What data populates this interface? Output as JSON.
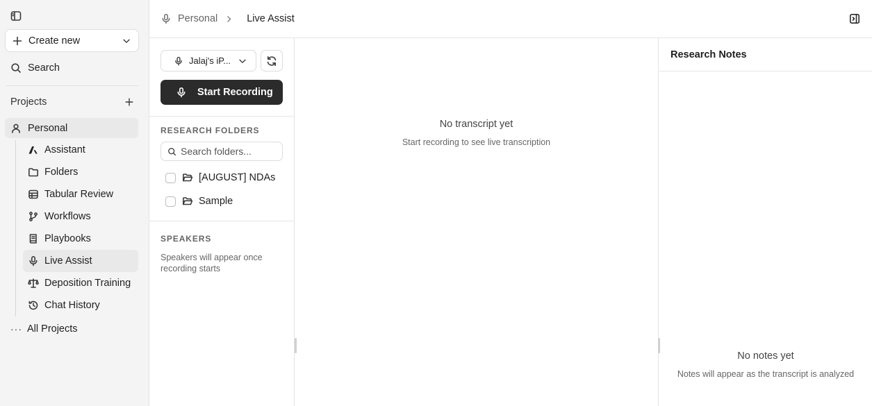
{
  "sidebar": {
    "create_label": "Create new",
    "search_label": "Search",
    "projects_label": "Projects",
    "personal_label": "Personal",
    "items": [
      {
        "label": "Assistant",
        "icon": "assistant-logo-icon"
      },
      {
        "label": "Folders",
        "icon": "folder-icon"
      },
      {
        "label": "Tabular Review",
        "icon": "table-icon"
      },
      {
        "label": "Workflows",
        "icon": "git-branch-icon"
      },
      {
        "label": "Playbooks",
        "icon": "book-icon"
      },
      {
        "label": "Live Assist",
        "icon": "microphone-icon",
        "active": true
      },
      {
        "label": "Deposition Training",
        "icon": "scale-icon"
      },
      {
        "label": "Chat History",
        "icon": "history-icon"
      }
    ],
    "all_projects_label": "All Projects"
  },
  "breadcrumb": {
    "parent": "Personal",
    "current": "Live Assist"
  },
  "controls": {
    "device_label": "Jalaj's iP...",
    "record_label": "Start Recording"
  },
  "research_folders": {
    "title": "RESEARCH FOLDERS",
    "search_placeholder": "Search folders...",
    "folders": [
      "[AUGUST] NDAs",
      "Sample"
    ]
  },
  "speakers": {
    "title": "SPEAKERS",
    "empty_message": "Speakers will appear once recording starts"
  },
  "transcript": {
    "empty_title": "No transcript yet",
    "empty_subtitle": "Start recording to see live transcription"
  },
  "notes": {
    "title": "Research Notes",
    "empty_title": "No notes yet",
    "empty_subtitle": "Notes will appear as the transcript is analyzed"
  }
}
